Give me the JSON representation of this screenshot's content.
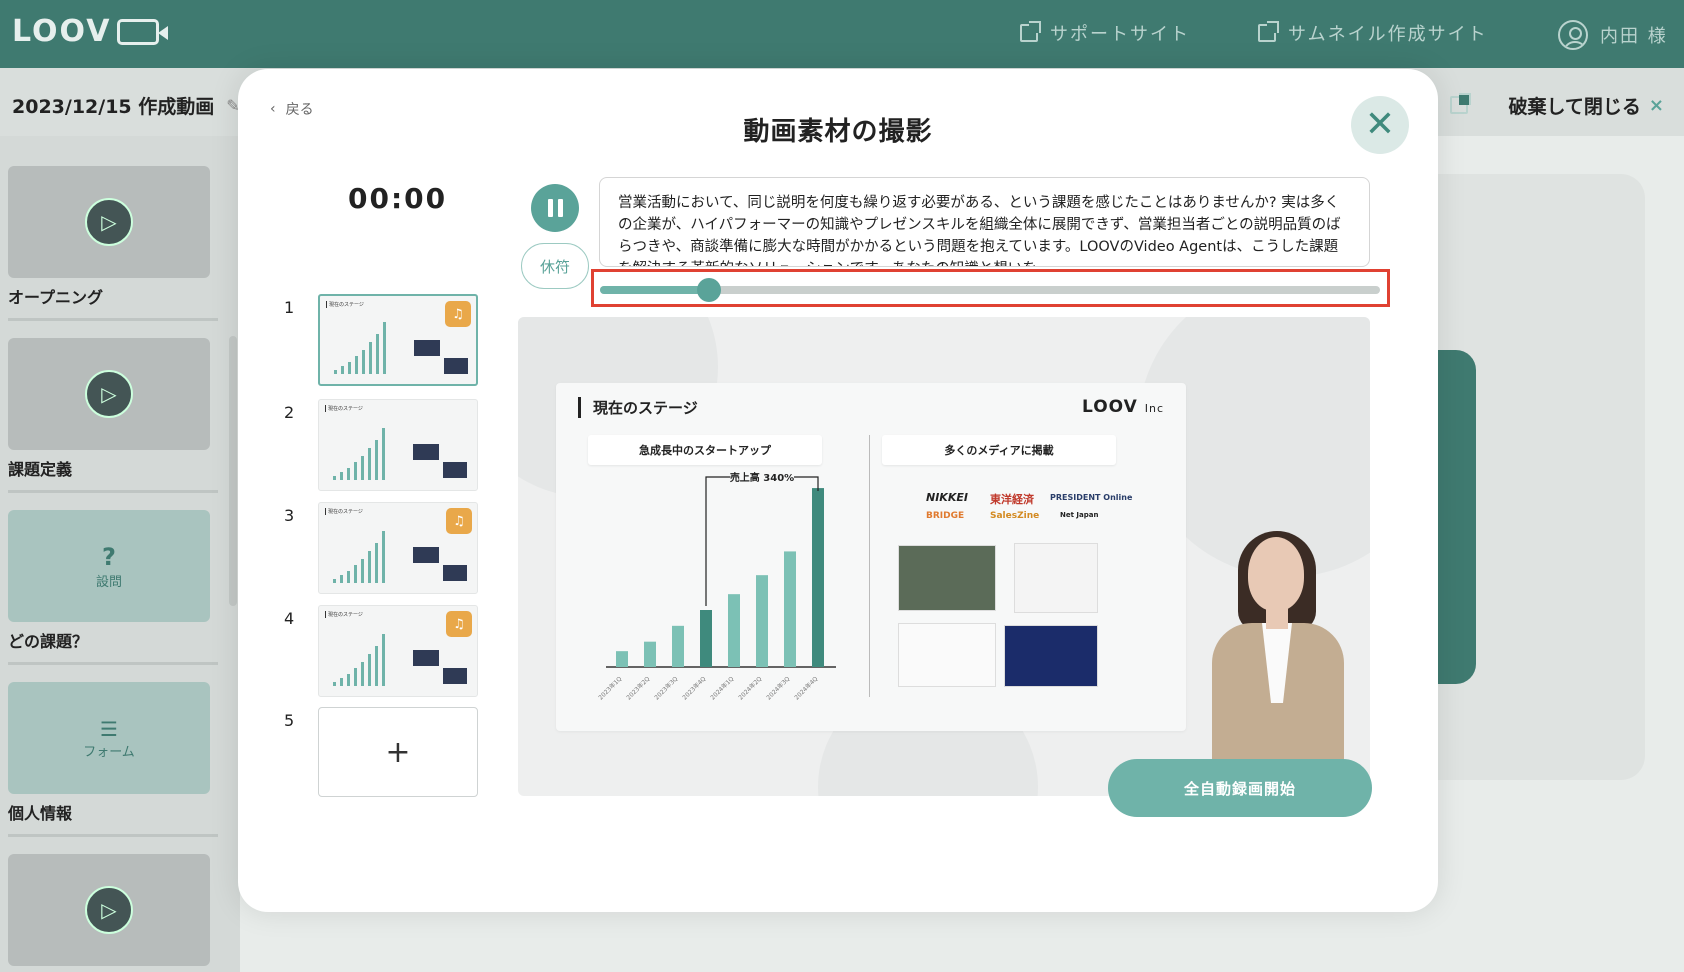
{
  "app": {
    "logo": "LOOV",
    "user_name": "内田 様"
  },
  "top_links": {
    "support": "サポートサイト",
    "thumbnail": "サムネイル作成サイト"
  },
  "header": {
    "doc_title": "2023/12/15 作成動画",
    "discard": "破棄して閉じる"
  },
  "sidebar": {
    "scenes": [
      {
        "label": "オープニング",
        "kind": "video"
      },
      {
        "label": "課題定義",
        "kind": "video"
      },
      {
        "label": "どの課題？",
        "kind": "question",
        "badge": "設問"
      },
      {
        "label": "個人情報",
        "kind": "form",
        "badge": "フォーム"
      },
      {
        "label": "",
        "kind": "video"
      }
    ]
  },
  "modal": {
    "back": "戻る",
    "title": "動画素材の撮影",
    "timer": "00:00",
    "pause_label": "休符",
    "script": "営業活動において、同じ説明を何度も繰り返す必要がある、という課題を感じたことはありませんか? 実は多くの企業が、ハイパフォーマーの知識やプレゼンスキルを組織全体に展開できず、営業担当者ごとの説明品質のばらつきや、商談準備に膨大な時間がかかるという問題を抱えています。LOOVのVideo Agentは、こうした課題を解決する革新的なソリューションです。あなたの知識と想いを",
    "progress": 0.14,
    "start_button": "全自動録画開始",
    "slides": [
      {
        "num": "1",
        "active": true,
        "audio": true
      },
      {
        "num": "2",
        "active": false,
        "audio": false
      },
      {
        "num": "3",
        "active": false,
        "audio": true
      },
      {
        "num": "4",
        "active": false,
        "audio": true
      },
      {
        "num": "5",
        "add": true
      }
    ]
  },
  "preview_slide": {
    "title": "現在のステージ",
    "brand": "LOOV",
    "brand_suffix": "Inc",
    "left_pill": "急成長中のスタートアップ",
    "right_pill": "多くのメディアに掲載",
    "annotation": "売上高 340%",
    "media": [
      "NIKKEI",
      "東洋経済",
      "PRESIDENT Online",
      "BRIDGE",
      "SalesZine",
      "Net Japan"
    ]
  },
  "chart_data": {
    "type": "bar",
    "title": "",
    "categories": [
      "2023年1Q",
      "2023年2Q",
      "2023年3Q",
      "2023年4Q",
      "2024年1Q",
      "2024年2Q",
      "2024年3Q",
      "2024年4Q"
    ],
    "values": [
      1.0,
      1.6,
      2.6,
      3.6,
      4.6,
      5.8,
      7.3,
      11.3
    ],
    "annotation": "売上高 340%",
    "colors": {
      "bar": "#7cc1b5",
      "highlight": "#3f8a7d"
    }
  }
}
